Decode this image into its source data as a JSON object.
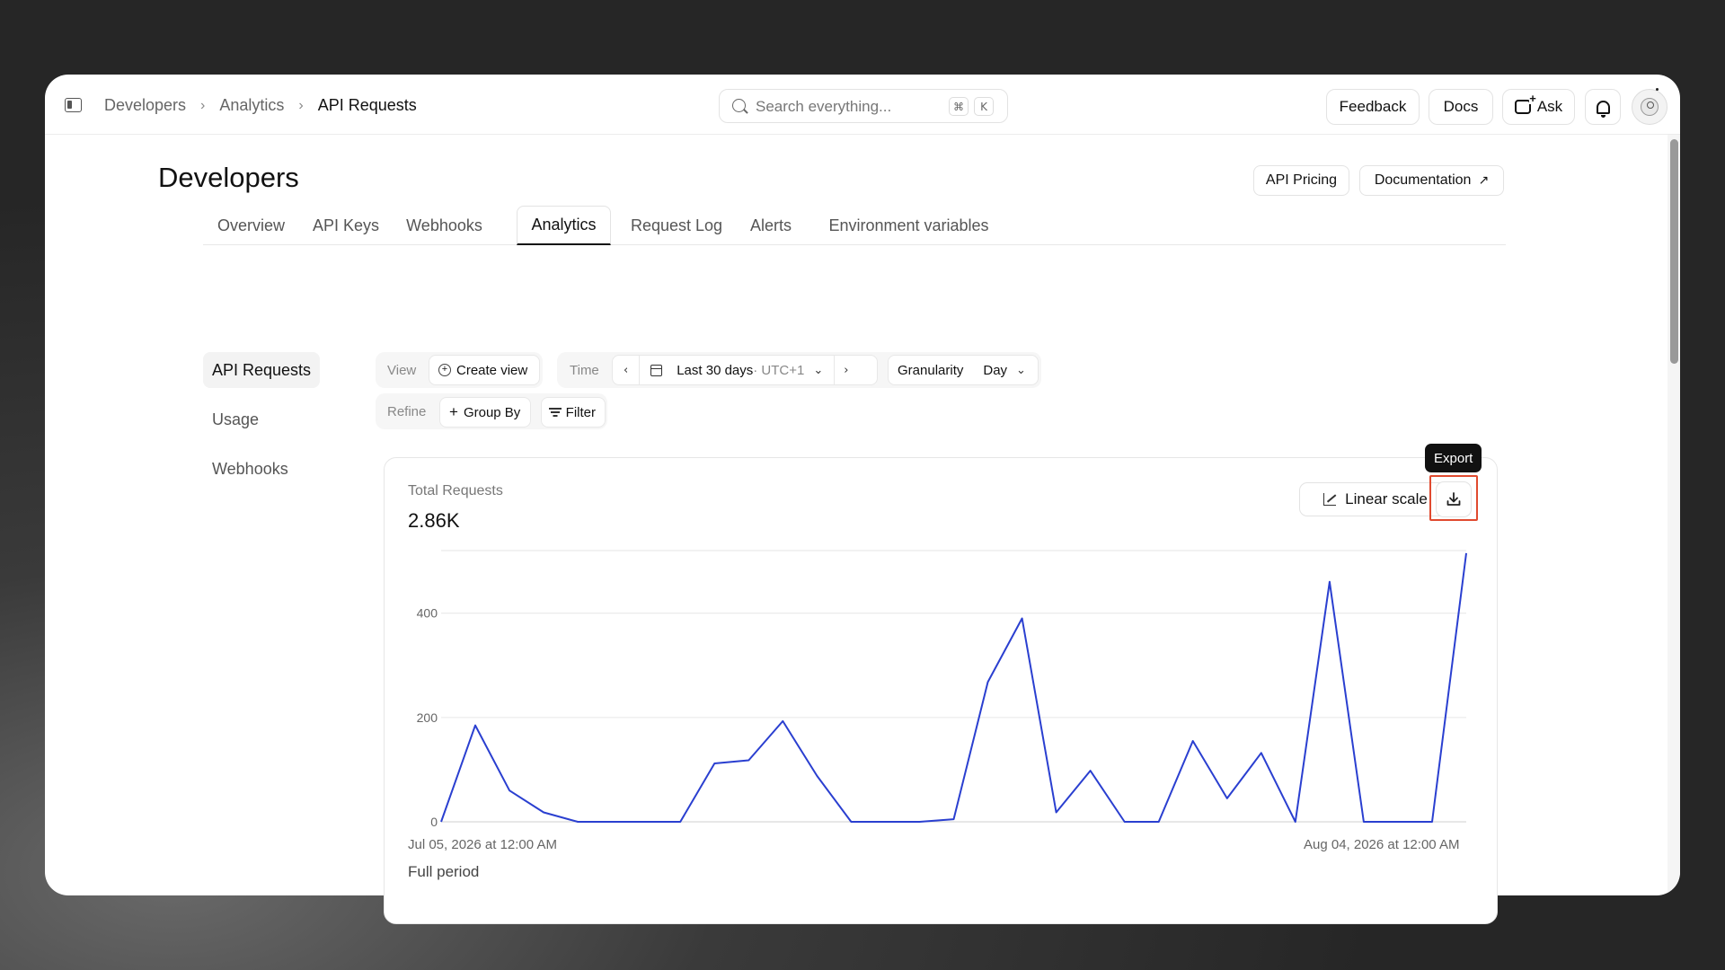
{
  "breadcrumb": [
    "Developers",
    "Analytics",
    "API Requests"
  ],
  "search": {
    "placeholder": "Search everything...",
    "shortcut_1": "⌘",
    "shortcut_2": "K"
  },
  "topbar": {
    "feedback": "Feedback",
    "docs": "Docs",
    "ask": "Ask"
  },
  "page": {
    "title": "Developers",
    "api_pricing": "API Pricing",
    "documentation": "Documentation",
    "external_arrow": "↗"
  },
  "tabs": [
    "Overview",
    "API Keys",
    "Webhooks",
    "Analytics",
    "Request Log",
    "Alerts",
    "Environment variables"
  ],
  "active_tab": "Analytics",
  "sidenav": [
    "API Requests",
    "Usage",
    "Webhooks"
  ],
  "filters": {
    "view_label": "View",
    "create_view": "Create view",
    "time_label": "Time",
    "prev": "‹",
    "range": "Last 30 days",
    "timezone": " · UTC+1",
    "next": "›",
    "granularity_label": "Granularity",
    "granularity_value": "Day",
    "refine_label": "Refine",
    "group_by": "Group By",
    "filter": "Filter"
  },
  "card": {
    "metric_label": "Total Requests",
    "metric_value": "2.86K",
    "scale_button": "Linear scale",
    "export_tooltip": "Export",
    "axis_start": "Jul 05, 2026 at 12:00 AM",
    "axis_end": "Aug 04, 2026 at 12:00 AM",
    "period_label": "Full period"
  },
  "colors": {
    "line": "#2a3fd0",
    "highlight": "#e04a2f"
  },
  "chart_data": {
    "type": "line",
    "x_start": "Jul 05, 2026",
    "x_end": "Aug 04, 2026",
    "yticks": [
      0,
      200,
      400
    ],
    "ylim": [
      0,
      520
    ],
    "series": [
      {
        "values": [
          0,
          185,
          60,
          18,
          0,
          0,
          0,
          0,
          112,
          118,
          193,
          88,
          0,
          0,
          0,
          5,
          268,
          390,
          18,
          98,
          0,
          0,
          155,
          45,
          132,
          0,
          460,
          0,
          0,
          0,
          515
        ]
      }
    ]
  }
}
